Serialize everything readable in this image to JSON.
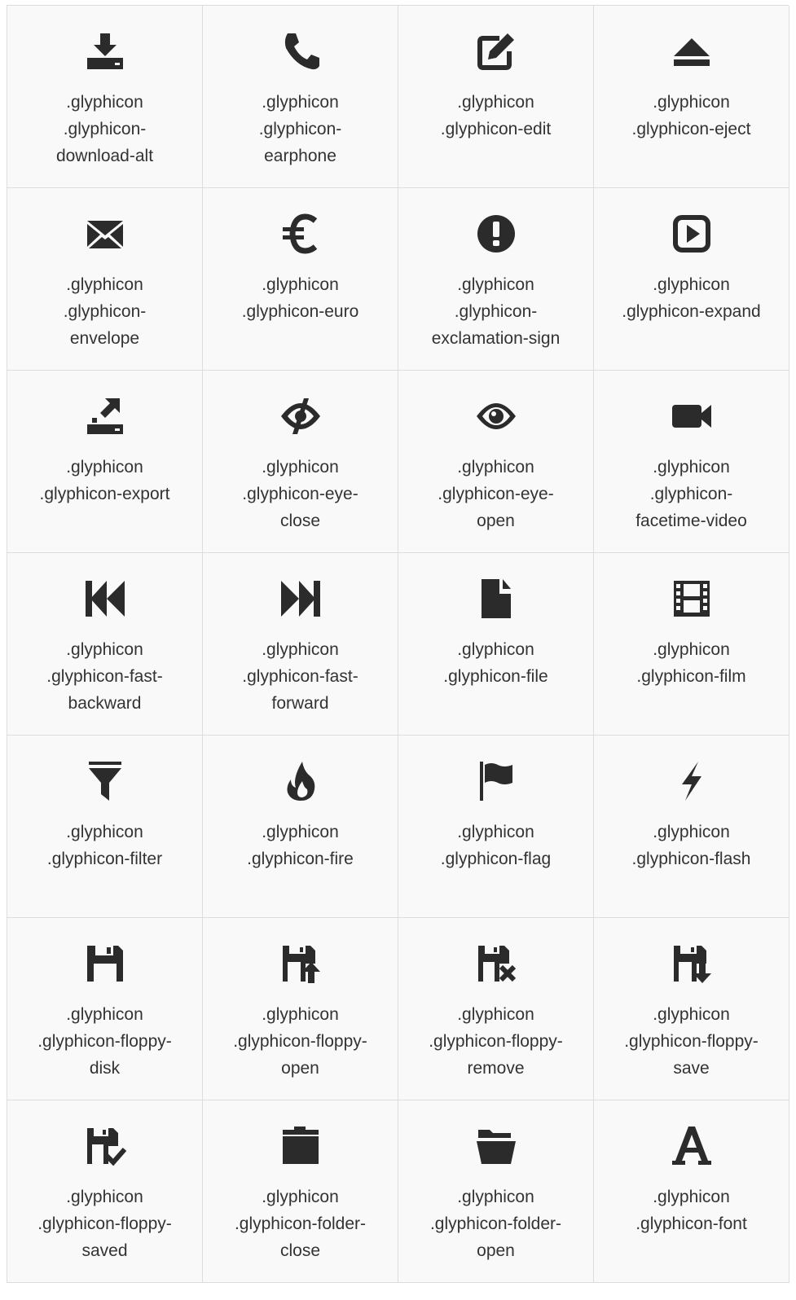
{
  "icon_color": "#2b2b2b",
  "glyphs": [
    {
      "icon": "download-alt-icon",
      "lines": [
        ".glyphicon",
        ".glyphicon-",
        "download-alt"
      ]
    },
    {
      "icon": "earphone-icon",
      "lines": [
        ".glyphicon",
        ".glyphicon-",
        "earphone"
      ]
    },
    {
      "icon": "edit-icon",
      "lines": [
        ".glyphicon",
        ".glyphicon-edit",
        ""
      ]
    },
    {
      "icon": "eject-icon",
      "lines": [
        ".glyphicon",
        ".glyphicon-eject",
        ""
      ]
    },
    {
      "icon": "envelope-icon",
      "lines": [
        ".glyphicon",
        ".glyphicon-",
        "envelope"
      ]
    },
    {
      "icon": "euro-icon",
      "lines": [
        ".glyphicon",
        ".glyphicon-euro",
        ""
      ]
    },
    {
      "icon": "exclamation-sign-icon",
      "lines": [
        ".glyphicon",
        ".glyphicon-",
        "exclamation-sign"
      ]
    },
    {
      "icon": "expand-icon",
      "lines": [
        ".glyphicon",
        ".glyphicon-expand",
        ""
      ]
    },
    {
      "icon": "export-icon",
      "lines": [
        ".glyphicon",
        ".glyphicon-export",
        ""
      ]
    },
    {
      "icon": "eye-close-icon",
      "lines": [
        ".glyphicon",
        ".glyphicon-eye-",
        "close"
      ]
    },
    {
      "icon": "eye-open-icon",
      "lines": [
        ".glyphicon",
        ".glyphicon-eye-",
        "open"
      ]
    },
    {
      "icon": "facetime-video-icon",
      "lines": [
        ".glyphicon",
        ".glyphicon-",
        "facetime-video"
      ]
    },
    {
      "icon": "fast-backward-icon",
      "lines": [
        ".glyphicon",
        ".glyphicon-fast-",
        "backward"
      ]
    },
    {
      "icon": "fast-forward-icon",
      "lines": [
        ".glyphicon",
        ".glyphicon-fast-",
        "forward"
      ]
    },
    {
      "icon": "file-icon",
      "lines": [
        ".glyphicon",
        ".glyphicon-file",
        ""
      ]
    },
    {
      "icon": "film-icon",
      "lines": [
        ".glyphicon",
        ".glyphicon-film",
        ""
      ]
    },
    {
      "icon": "filter-icon",
      "lines": [
        ".glyphicon",
        ".glyphicon-filter",
        ""
      ]
    },
    {
      "icon": "fire-icon",
      "lines": [
        ".glyphicon",
        ".glyphicon-fire",
        ""
      ]
    },
    {
      "icon": "flag-icon",
      "lines": [
        ".glyphicon",
        ".glyphicon-flag",
        ""
      ]
    },
    {
      "icon": "flash-icon",
      "lines": [
        ".glyphicon",
        ".glyphicon-flash",
        ""
      ]
    },
    {
      "icon": "floppy-disk-icon",
      "lines": [
        ".glyphicon",
        ".glyphicon-floppy-",
        "disk"
      ]
    },
    {
      "icon": "floppy-open-icon",
      "lines": [
        ".glyphicon",
        ".glyphicon-floppy-",
        "open"
      ]
    },
    {
      "icon": "floppy-remove-icon",
      "lines": [
        ".glyphicon",
        ".glyphicon-floppy-",
        "remove"
      ]
    },
    {
      "icon": "floppy-save-icon",
      "lines": [
        ".glyphicon",
        ".glyphicon-floppy-",
        "save"
      ]
    },
    {
      "icon": "floppy-saved-icon",
      "lines": [
        ".glyphicon",
        ".glyphicon-floppy-",
        "saved"
      ]
    },
    {
      "icon": "folder-close-icon",
      "lines": [
        ".glyphicon",
        ".glyphicon-folder-",
        "close"
      ]
    },
    {
      "icon": "folder-open-icon",
      "lines": [
        ".glyphicon",
        ".glyphicon-folder-",
        "open"
      ]
    },
    {
      "icon": "font-icon",
      "lines": [
        ".glyphicon",
        ".glyphicon-font",
        ""
      ]
    }
  ]
}
